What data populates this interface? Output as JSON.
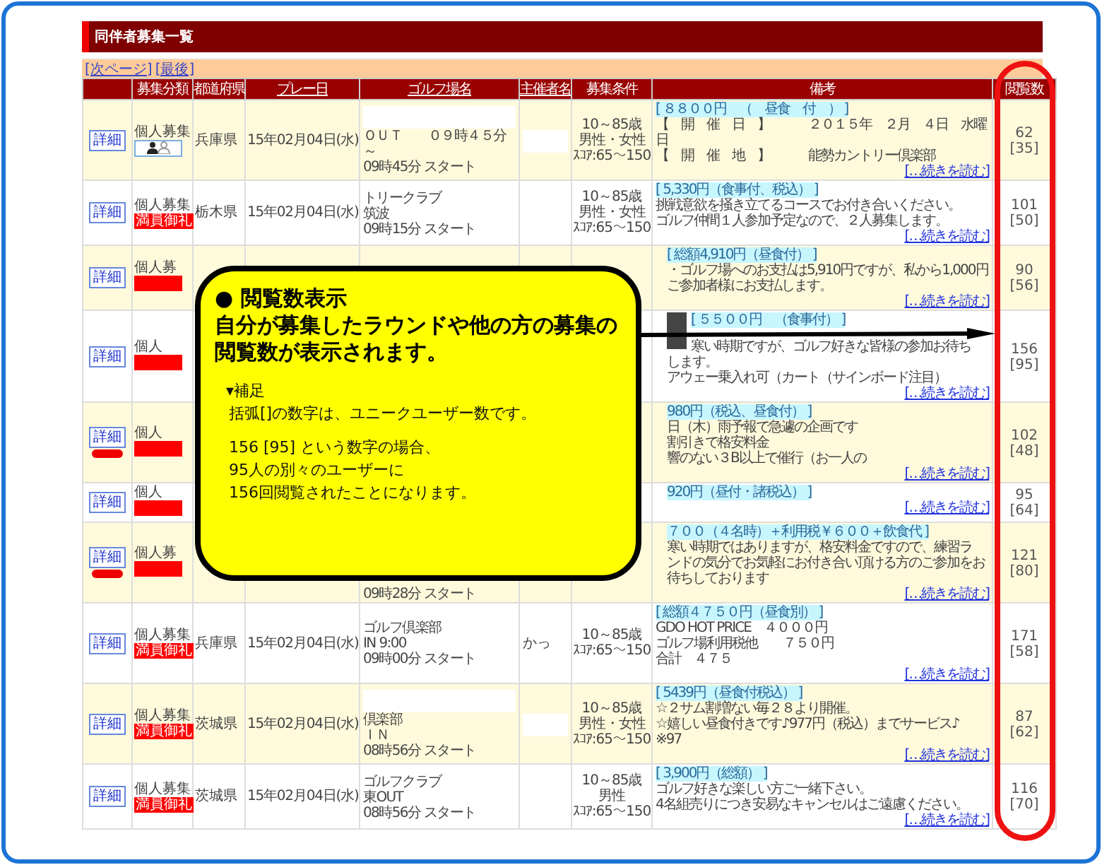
{
  "title": "同伴者募集一覧",
  "nav_links": [
    "[次ページ]",
    "[最後]"
  ],
  "columns": [
    {
      "label": "募集分類",
      "link": false
    },
    {
      "label": "都道府県",
      "link": false
    },
    {
      "label": "プレー日",
      "link": true
    },
    {
      "label": "ゴルフ場名",
      "link": true
    },
    {
      "label": "主催者名",
      "link": true
    },
    {
      "label": "募集条件",
      "link": false
    },
    {
      "label": "備考",
      "link": false
    },
    {
      "label": "閲覧数",
      "link": false
    }
  ],
  "rows": [
    {
      "detail": "詳細",
      "new": false,
      "category": "個人募集",
      "badge": {
        "kind": "pair"
      },
      "pref": "兵庫県",
      "date": "15年02月04日(水)",
      "golf_blank": true,
      "golf": [
        "ＯＵＴ　　０９時４５分～",
        "09時45分 スタート"
      ],
      "host_blank": true,
      "cond": [
        "10～85歳",
        "男性・女性",
        "ｽｺｱ:65～150"
      ],
      "notes": {
        "price": "[ ８８００円　（　昼食　付　） ]",
        "lines": [
          "【　開　催　日　】　　　２０１５年　２月　４日　水曜日",
          "【　開　催　地　】　　　能勢カントリー倶楽部"
        ],
        "more": "[…続きを読む]"
      },
      "views": "62",
      "unique": "[35]"
    },
    {
      "detail": "詳細",
      "new": false,
      "category": "個人募集",
      "badge": {
        "kind": "full",
        "text": "満員御礼"
      },
      "pref": "栃木県",
      "date": "15年02月04日(水)",
      "golf": [
        "トリークラブ",
        "筑波",
        "09時15分 スタート"
      ],
      "cond": [
        "10～85歳",
        "男性・女性",
        "ｽｺｱ:65～150"
      ],
      "notes": {
        "price": "[ 5,330円（食事付、税込） ]",
        "lines": [
          "挑戦意欲を掻き立てるコースでお付き合いください。",
          "ゴルフ仲間１人参加予定なので、２人募集します。"
        ],
        "more": "[…続きを読む]"
      },
      "views": "101",
      "unique": "[50]"
    },
    {
      "detail": "詳細",
      "new": false,
      "covered": true,
      "category": "個人募",
      "badge": {
        "kind": "full"
      },
      "notes": {
        "price": "[ 総額4,910円（昼食付） ]",
        "lines": [
          "・ゴルフ場へのお支払は5,910円ですが、私から1,000円",
          "ご参加者様にお支払します。"
        ],
        "more": "[…続きを読む]"
      },
      "views": "90",
      "unique": "[56]"
    },
    {
      "detail": "詳細",
      "new": false,
      "covered": true,
      "category": "個人",
      "badge": {
        "kind": "full"
      },
      "notes": {
        "photo": true,
        "price": "[ ５５００円　（食事付） ]",
        "lines": [
          "寒い時期ですが、ゴルフ好きな皆様の参加お待ち",
          "します。",
          "アウェー乗入れ可（カート（サインボード注目）"
        ],
        "more": "[…続きを読む]"
      },
      "views": "156",
      "unique": "[95]"
    },
    {
      "detail": "詳細",
      "new": true,
      "covered": true,
      "category": "個人",
      "badge": {
        "kind": "full"
      },
      "notes": {
        "price": "980円（税込、昼食付） ]",
        "lines": [
          "日（木）雨予報で急遽の企画です",
          "割引きで格安料金",
          "響のない３B以上で催行（お一人の"
        ],
        "more": "[…続きを読む]"
      },
      "views": "102",
      "unique": "[48]"
    },
    {
      "detail": "詳細",
      "new": false,
      "covered": true,
      "category": "個人",
      "badge": {
        "kind": "full"
      },
      "notes": {
        "price": "920円（昼付・諸税込） ]",
        "more": "[…続きを読む]"
      },
      "views": "95",
      "unique": "[64]"
    },
    {
      "detail": "詳細",
      "new": true,
      "covered": true,
      "category": "個人募",
      "badge": {
        "kind": "full"
      },
      "golf": [
        "09時28分 スタート"
      ],
      "notes": {
        "price": "７００（４名時）＋利用税￥６００＋飲食代 ]",
        "lines": [
          "寒い時期ではありますが、格安料金ですので、練習ラ",
          "ンドの気分でお気軽にお付き合い頂ける方のご参加をお",
          "待ちしております"
        ],
        "more": "[…続きを読む]"
      },
      "views": "121",
      "unique": "[80]"
    },
    {
      "detail": "詳細",
      "new": false,
      "category": "個人募集",
      "badge": {
        "kind": "full",
        "text": "満員御礼"
      },
      "pref": "兵庫県",
      "date": "15年02月04日(水)",
      "golf": [
        "ゴルフ倶楽部",
        "IN 9:00",
        "09時00分 スタート"
      ],
      "host": "かっ",
      "cond": [
        "10～85歳",
        "ｽｺｱ:65～150"
      ],
      "notes": {
        "price": "[ 総額４７５０円（昼食別） ]",
        "lines": [
          "GDO HOT PRICE　４０００円",
          "ゴルフ場利用税他　　７５０円",
          "合計　４７５"
        ],
        "more": "[…続きを読む]"
      },
      "views": "171",
      "unique": "[58]"
    },
    {
      "detail": "詳細",
      "new": false,
      "category": "個人募集",
      "badge": {
        "kind": "full",
        "text": "満員御礼"
      },
      "pref": "茨城県",
      "date": "15年02月04日(水)",
      "golf_blank": true,
      "golf": [
        "倶楽部",
        "ＩＮ",
        "08時56分 スタート"
      ],
      "host_blank": true,
      "cond": [
        "10～85歳",
        "男性・女性",
        "ｽｺｱ:65～150"
      ],
      "notes": {
        "price": "[ 5439円（昼食付税込） ]",
        "lines": [
          "☆２サム割増ない毎２８より開催。",
          "☆嬉しい昼食付きです♪977円（税込）までサービス♪",
          "※97"
        ],
        "more": "[…続きを読む]"
      },
      "views": "87",
      "unique": "[62]"
    },
    {
      "detail": "詳細",
      "new": false,
      "category": "個人募集",
      "badge": {
        "kind": "full",
        "text": "満員御礼"
      },
      "pref": "茨城県",
      "date": "15年02月04日(水)",
      "golf": [
        "ゴルフクラブ",
        "東OUT",
        "08時56分 スタート"
      ],
      "cond": [
        "10～85歳",
        "男性",
        "ｽｺｱ:65～150"
      ],
      "notes": {
        "price": "[ 3,900円（総額） ]",
        "lines": [
          "ゴルフ好きな楽しい方ご一緒下さい。",
          "4名組売りにつき安易なキャンセルはご遠慮ください。"
        ],
        "more": "[…続きを読む]"
      },
      "views": "116",
      "unique": "[70]"
    }
  ],
  "callout": {
    "heading": "●  閲覧数表示",
    "lead": "自分が募集したラウンドや他の方の募集の閲覧数が表示されます。",
    "note_label": "▾補足",
    "note_paragraphs": [
      [
        "括弧[]の数字は、ユニークユーザー数です。"
      ],
      [
        "156 [95] という数字の場合、",
        "95人の別々のユーザーに",
        "156回閲覧されたことになります。"
      ]
    ]
  }
}
